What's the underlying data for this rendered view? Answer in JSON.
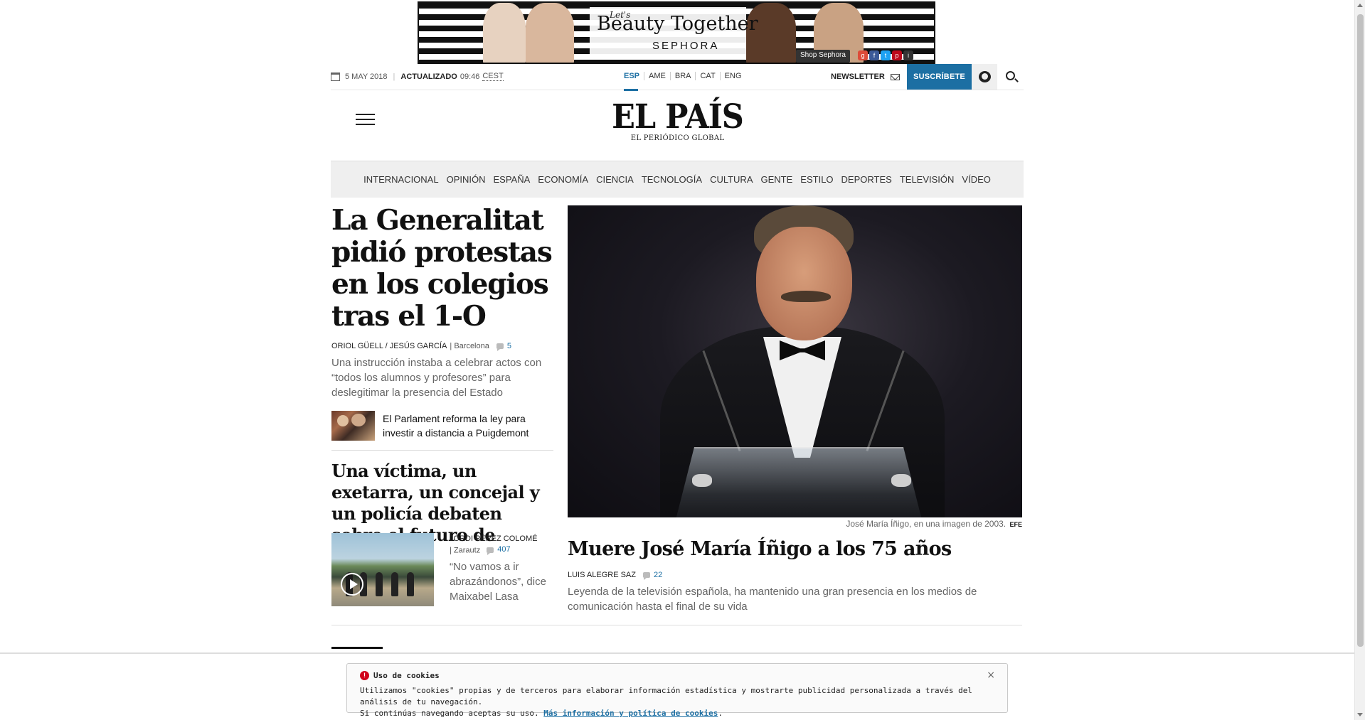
{
  "ad": {
    "tagline": "Let's",
    "headline": "Beauty Together",
    "brand": "SEPHORA",
    "shop_label": "Shop Sephora"
  },
  "topbar": {
    "date": "5 MAY 2018",
    "updated_label": "ACTUALIZADO",
    "updated_time": "09:46",
    "timezone": "CEST",
    "editions": [
      "ESP",
      "AME",
      "BRA",
      "CAT",
      "ENG"
    ],
    "active_edition": "ESP",
    "newsletter_label": "NEWSLETTER",
    "subscribe_label": "SUSCRÍBETE"
  },
  "masthead": {
    "logo": "EL PAÍS",
    "tagline": "EL PERIÓDICO GLOBAL"
  },
  "sections": [
    "INTERNACIONAL",
    "OPINIÓN",
    "ESPAÑA",
    "ECONOMÍA",
    "CIENCIA",
    "TECNOLOGÍA",
    "CULTURA",
    "GENTE",
    "ESTILO",
    "DEPORTES",
    "TELEVISIÓN",
    "VÍDEO"
  ],
  "articles": {
    "lead": {
      "headline": "La Generalitat pidió protestas en los colegios tras el 1-O",
      "authors": "ORIOL GÜELL / JESÚS GARCÍA",
      "location": "| Barcelona",
      "comments": "5",
      "summary": "Una instrucción instaba a celebrar actos con “todos los alumnos y profesores” para deslegitimar la presencia del Estado",
      "related": "El Parlament reforma la ley para investir a distancia a Puigdemont"
    },
    "second": {
      "headline": "Una víctima, un exetarra, un concejal y un policía debaten sobre el futuro de Euskadi",
      "author": "JORDI PÉREZ COLOMÉ",
      "location": "| Zarautz",
      "comments": "407",
      "quote": "“No vamos a ir abrazándonos”, dice Maixabel Lasa"
    },
    "feature": {
      "caption": "José María Íñigo, en una imagen de 2003.",
      "caption_source": "EFE",
      "headline": "Muere José María Íñigo a los 75 años",
      "author": "LUIS ALEGRE SAZ",
      "comments": "22",
      "summary": "Leyenda de la televisión española, ha mantenido una gran presencia en los medios de comunicación hasta el final de su vida"
    }
  },
  "cookies": {
    "title": "Uso de cookies",
    "text_line1": "Utilizamos \"cookies\" propias y de terceros para elaborar información estadística y mostrarte publicidad personalizada a través del análisis de tu navegación.",
    "text_line2": "Si continúas navegando aceptas su uso.",
    "link": "Más información y política de cookies",
    "close": "×"
  }
}
